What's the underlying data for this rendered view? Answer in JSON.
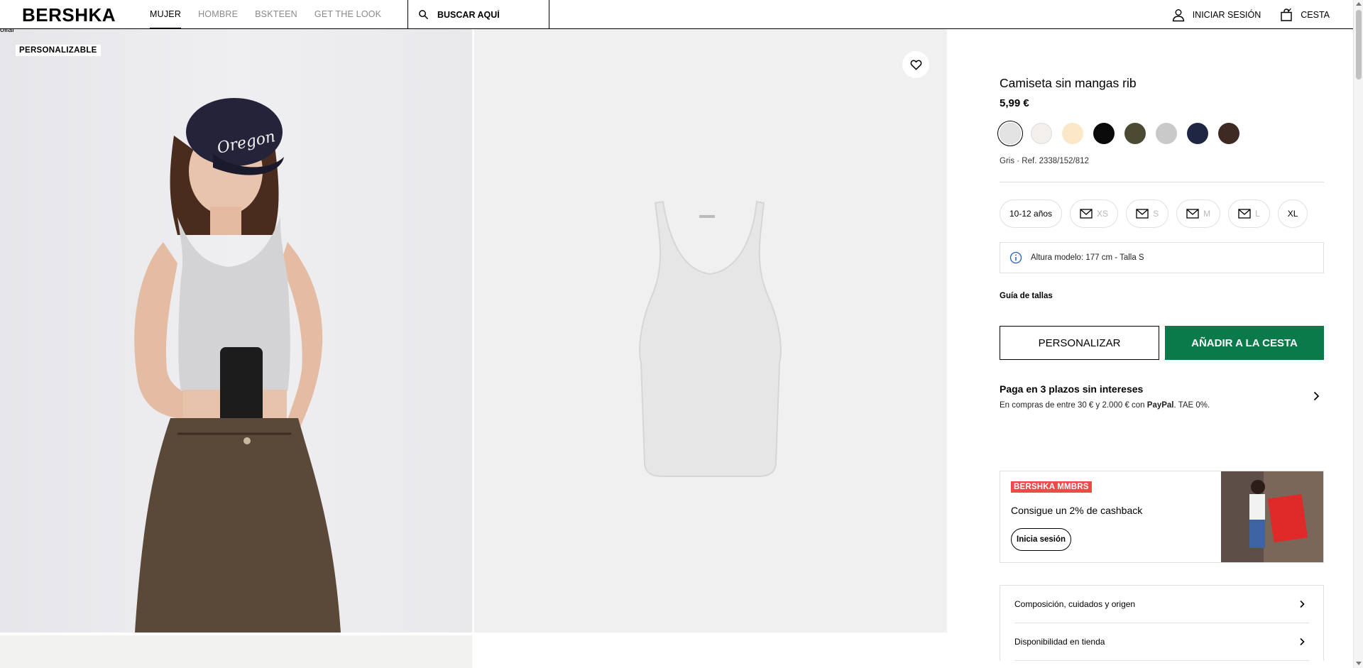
{
  "header": {
    "logo": "BERSHKA",
    "nav": [
      "MUJER",
      "HOMBRE",
      "BSKTEEN",
      "GET THE LOOK"
    ],
    "active_nav": "MUJER",
    "search_placeholder": "BUSCAR AQUÍ",
    "login_label": "INICIAR SESIÓN",
    "cart_label": "CESTA"
  },
  "gallery": {
    "cut_text": "ollar",
    "tag": "PERSONALIZABLE"
  },
  "product": {
    "title": "Camiseta sin mangas rib",
    "price": "5,99 €",
    "colors": [
      "#e3e3e3",
      "#f3efea",
      "#fbe8c8",
      "#0a0a0a",
      "#4b4a33",
      "#c9c9c9",
      "#1f2643",
      "#3e2a23"
    ],
    "selected_color_index": 0,
    "ref": "Gris · Ref. 2338/152/812",
    "sizes": [
      {
        "label": "10-12 años",
        "available": true,
        "notify": false
      },
      {
        "label": "XS",
        "available": false,
        "notify": true
      },
      {
        "label": "S",
        "available": false,
        "notify": true
      },
      {
        "label": "M",
        "available": false,
        "notify": true
      },
      {
        "label": "L",
        "available": false,
        "notify": true
      },
      {
        "label": "XL",
        "available": true,
        "notify": false
      }
    ],
    "model_info": "Altura modelo: 177 cm - Talla S",
    "size_guide": "Guía de tallas",
    "btn_personalize": "PERSONALIZAR",
    "btn_add": "AÑADIR A LA CESTA",
    "payment": {
      "title": "Paga en 3 plazos sin intereses",
      "sub_pre": "En compras de entre 30 € y 2.000 € con ",
      "sub_brand": "PayPal",
      "sub_post": ". TAE 0%."
    },
    "promo": {
      "badge": "BERSHKA MMBRS",
      "text": "Consigue un 2% de cashback",
      "button": "Inicia sesión"
    },
    "accordion": [
      "Composición, cuidados y origen",
      "Disponibilidad en tienda"
    ]
  }
}
